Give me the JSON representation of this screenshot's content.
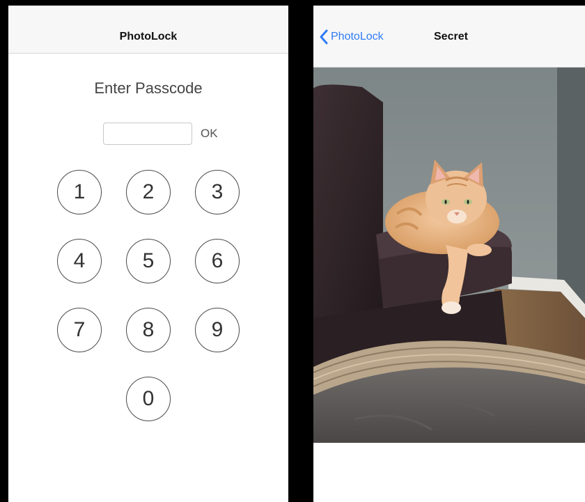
{
  "left_screen": {
    "nav_title": "PhotoLock",
    "prompt": "Enter Passcode",
    "passcode_value": "",
    "ok_label": "OK",
    "keys": [
      "1",
      "2",
      "3",
      "4",
      "5",
      "6",
      "7",
      "8",
      "9",
      "0"
    ]
  },
  "right_screen": {
    "back_label": "PhotoLock",
    "back_icon": "chevron-left-icon",
    "nav_title": "Secret",
    "photo_subject": "orange tabby cat resting on dark leather armchair beside a wicker basket"
  },
  "colors": {
    "accent": "#2f7cf6",
    "navbar_bg": "#f7f7f7",
    "frame_bg": "#000000"
  }
}
